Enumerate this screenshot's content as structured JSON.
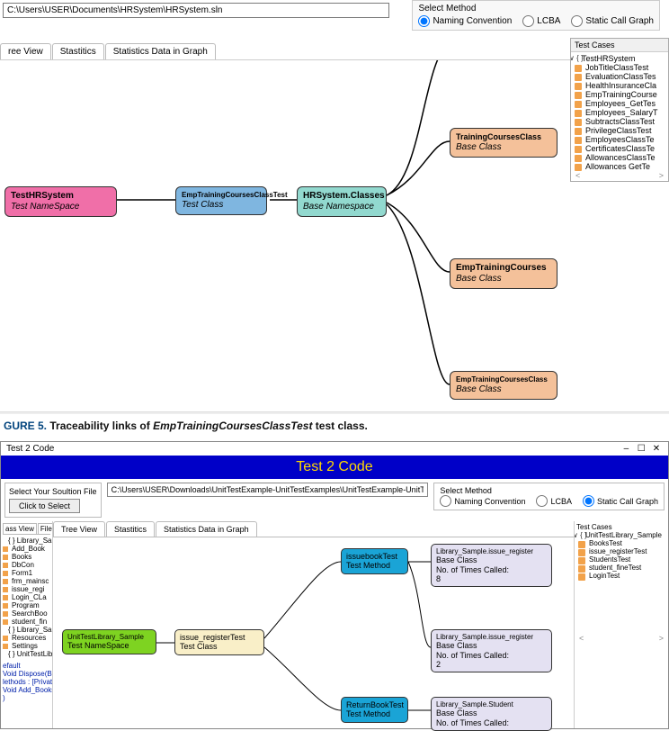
{
  "top": {
    "path": "C:\\Users\\USER\\Documents\\HRSystem\\HRSystem.sln",
    "method_label": "Select Method",
    "methods": [
      "Naming Convention",
      "LCBA",
      "Static Call Graph"
    ],
    "method_selected": 0,
    "tabs": [
      "ree View",
      "Stastitics",
      "Statistics Data in Graph"
    ],
    "nodes": {
      "ns": {
        "title": "TestHRSystem",
        "sub": "Test NameSpace"
      },
      "tc": {
        "title": "EmpTrainingCoursesClassTest",
        "sub": "Test Class"
      },
      "bns": {
        "title": "HRSystem.Classes",
        "sub": "Base Namespace"
      },
      "bc1": {
        "title": "TrainingCoursesClass",
        "sub": "Base Class"
      },
      "bc2": {
        "title": "EmpTrainingCourses",
        "sub": "Base Class"
      },
      "bc3": {
        "title": "EmpTrainingCoursesClass",
        "sub": "Base Class"
      }
    },
    "testcases_header": "Test Cases",
    "testcases_root": "TestHRSystem",
    "testcases": [
      "JobTitleClassTest",
      "EvaluationClassTes",
      "HealthInsuranceCla",
      "EmpTrainingCourse",
      "Employees_GetTes",
      "Employees_SalaryT",
      "SubtractsClassTest",
      "PrivilegeClassTest",
      "EmployeesClassTe",
      "CertificatesClassTe",
      "AllowancesClassTe",
      "Allowances GetTe"
    ]
  },
  "caption": {
    "prefix": "GURE 5.",
    "text1": "Traceability links of ",
    "em": "EmpTrainingCoursesClassTest",
    "text2": " test class."
  },
  "bottom": {
    "winbar_title": "Test 2 Code",
    "winbar_min": "–",
    "winbar_max": "☐",
    "winbar_close": "✕",
    "app_title": "Test 2 Code",
    "select_file_label": "Select Your Soultion File",
    "select_btn": "Click to Select",
    "path": "C:\\Users\\USER\\Downloads\\UnitTestExample-UnitTestExamples\\UnitTestExample-UnitTestExamples\\Library_Sample.sln",
    "method_label": "Select Method",
    "methods": [
      "Naming Convention",
      "LCBA",
      "Static Call Graph"
    ],
    "method_selected": 2,
    "left_tabs": [
      "ass View",
      "File View"
    ],
    "tabs2": [
      "Tree View",
      "Stastitics",
      "Statistics Data in Graph"
    ],
    "left_tree_g1_label": "{ } Library_Sample",
    "left_tree_g1": [
      "Add_Book",
      "Books",
      "DbCon",
      "Form1",
      "frm_mainsc",
      "issue_regi",
      "Login_CLa",
      "Program",
      "SearchBoo",
      "student_fin"
    ],
    "left_tree_g2_label": "{ } Library_Sample",
    "left_tree_g2": [
      "Resources",
      "Settings"
    ],
    "left_tree_g3_label": "{ } UnitTestLibrary",
    "left_extra": [
      "efault",
      "Void Dispose(Boole",
      "lethods : [Private]",
      "Void Add_Books_L",
      ")"
    ],
    "right_hdr": "Test Cases",
    "right_root": "UnitTestLibrary_Sample",
    "right_items": [
      "BooksTest",
      "issue_registerTest",
      "StudentsTest",
      "student_fineTest",
      "LoginTest"
    ],
    "nodes2": {
      "ns": {
        "title": "UnitTestLibrary_Sample",
        "sub": "Test NameSpace"
      },
      "tc": {
        "title": "issue_registerTest",
        "sub": "Test Class"
      },
      "m1": {
        "title": "issuebookTest",
        "sub": "Test Method"
      },
      "m2": {
        "title": "ReturnBookTest",
        "sub": "Test Method"
      },
      "b1": {
        "title": "Library_Sample.issue_register",
        "sub": "Base Class",
        "extra": "No. of Times Called:",
        "n": "8"
      },
      "b2": {
        "title": "Library_Sample.issue_register",
        "sub": "Base Class",
        "extra": "No. of Times Called:",
        "n": "2"
      },
      "b3": {
        "title": "Library_Sample.Student",
        "sub": "Base Class",
        "extra": "No. of Times Called:",
        "n": ""
      }
    }
  }
}
